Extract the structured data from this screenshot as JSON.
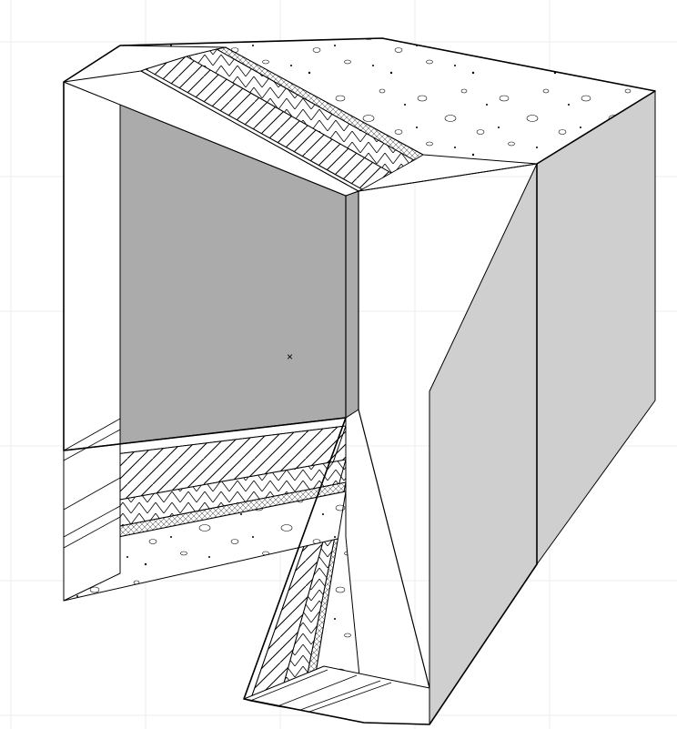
{
  "scene": {
    "app": "archicad-3d-viewport",
    "object": "composite-wall-corner-3d",
    "origin_marker": "×",
    "grid": {
      "visible": true,
      "color": "#ededed",
      "spacing_px": 148
    },
    "layers": [
      {
        "name": "air-layer",
        "fill": "#ababab",
        "hatch": "none",
        "order": 0
      },
      {
        "name": "gypsum-board",
        "fill": "#ffffff",
        "hatch": "outline",
        "order": 1
      },
      {
        "name": "wood-framing",
        "fill": "#ffffff",
        "hatch": "diagonal",
        "order": 2
      },
      {
        "name": "insulation-batt",
        "fill": "#ffffff",
        "hatch": "zigzag",
        "order": 3
      },
      {
        "name": "air-gap",
        "fill": "#ffffff",
        "hatch": "crosshatch",
        "order": 4
      },
      {
        "name": "concrete-veneer",
        "fill": "#ffffff",
        "hatch": "speckle",
        "order": 5
      }
    ],
    "colors": {
      "edge": "#000000",
      "inner_face": "#ababab",
      "outer_face": "#cfcfcf",
      "grid": "#ededed",
      "bg": "#ffffff"
    }
  }
}
